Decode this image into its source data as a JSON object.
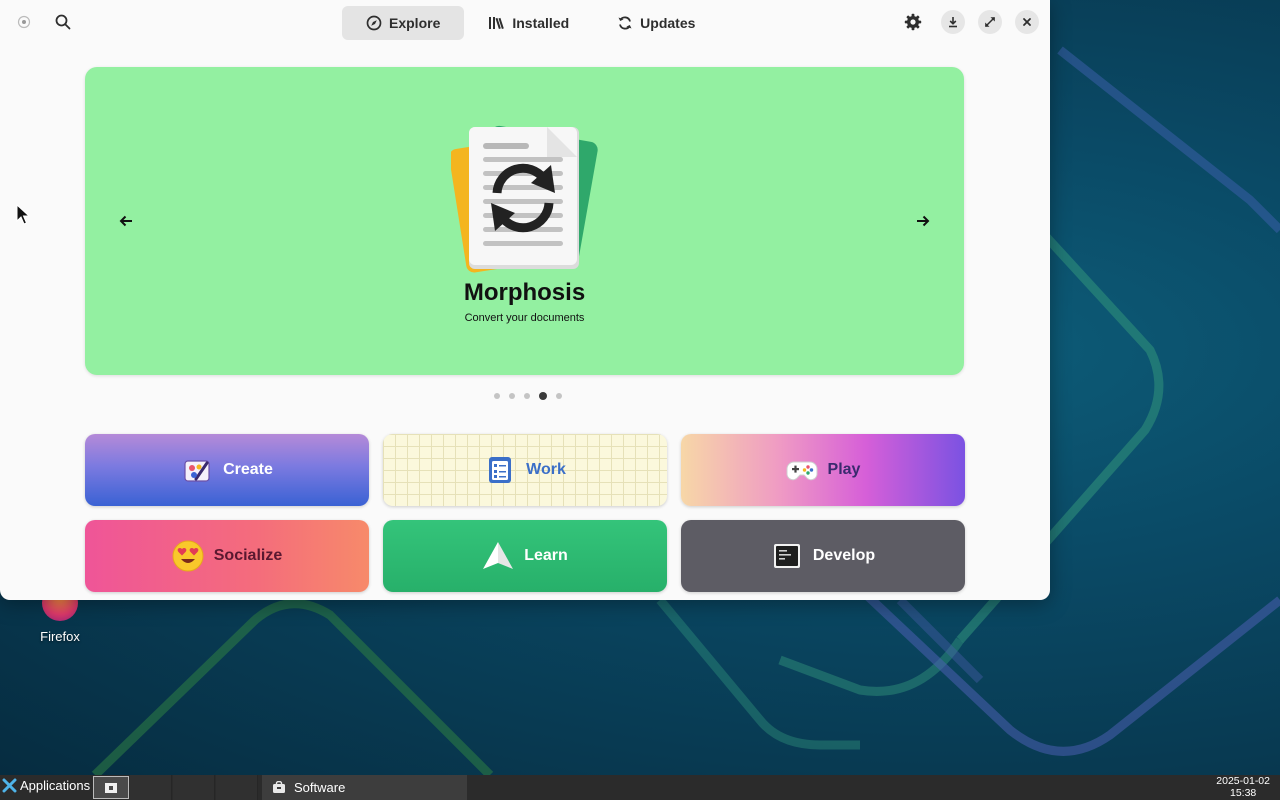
{
  "window": {
    "tabs": [
      {
        "label": "Explore",
        "active": true
      },
      {
        "label": "Installed",
        "active": false
      },
      {
        "label": "Updates",
        "active": false
      }
    ]
  },
  "carousel": {
    "featured": {
      "name": "Morphosis",
      "subtitle": "Convert your documents",
      "background": "#93f0a1"
    },
    "page_count": 5,
    "active_page": 4
  },
  "categories": [
    {
      "label": "Create",
      "icon": "paint-palette-icon"
    },
    {
      "label": "Work",
      "icon": "checklist-icon"
    },
    {
      "label": "Play",
      "icon": "gamepad-icon"
    },
    {
      "label": "Socialize",
      "icon": "heart-eyes-emoji-icon"
    },
    {
      "label": "Learn",
      "icon": "paper-plane-icon"
    },
    {
      "label": "Develop",
      "icon": "terminal-icon"
    }
  ],
  "desktop": {
    "icons": [
      {
        "label": "Firefox",
        "icon": "firefox-icon"
      }
    ]
  },
  "panel": {
    "applications_label": "Applications",
    "task_label": "Software",
    "clock_date": "2025-01-02",
    "clock_time": "15:38"
  }
}
